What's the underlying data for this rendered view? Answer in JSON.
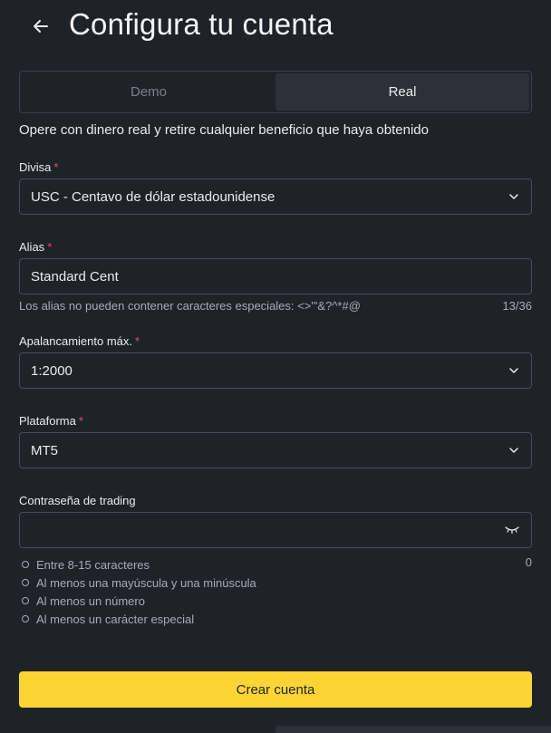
{
  "header": {
    "title": "Configura tu cuenta"
  },
  "tabs": [
    {
      "label": "Demo",
      "active": false
    },
    {
      "label": "Real",
      "active": true
    }
  ],
  "subtitle": "Opere con dinero real y retire cualquier beneficio que haya obtenido",
  "currency": {
    "label": "Divisa",
    "required_mark": "*",
    "value": "USC - Centavo de dólar estadounidense"
  },
  "alias": {
    "label": "Alias",
    "required_mark": "*",
    "value": "Standard Cent",
    "hint": "Los alias no pueden contener caracteres especiales: <>\"'&?^*#@",
    "counter": "13/36"
  },
  "leverage": {
    "label": "Apalancamiento máx.",
    "required_mark": "*",
    "value": "1:2000"
  },
  "platform": {
    "label": "Plataforma",
    "required_mark": "*",
    "value": "MT5"
  },
  "password": {
    "label": "Contraseña de trading",
    "value": "",
    "counter": "0",
    "rules": [
      "Entre 8-15 caracteres",
      "Al menos una mayúscula y una minúscula",
      "Al menos un número",
      "Al menos un carácter especial"
    ]
  },
  "submit_label": "Crear cuenta",
  "colors": {
    "accent": "#fcd535",
    "required": "#f6465d",
    "background": "#1e2329"
  },
  "icons": {
    "back": "arrow-left-icon",
    "dropdown": "chevron-down-icon",
    "visibility": "eye-closed-icon"
  }
}
